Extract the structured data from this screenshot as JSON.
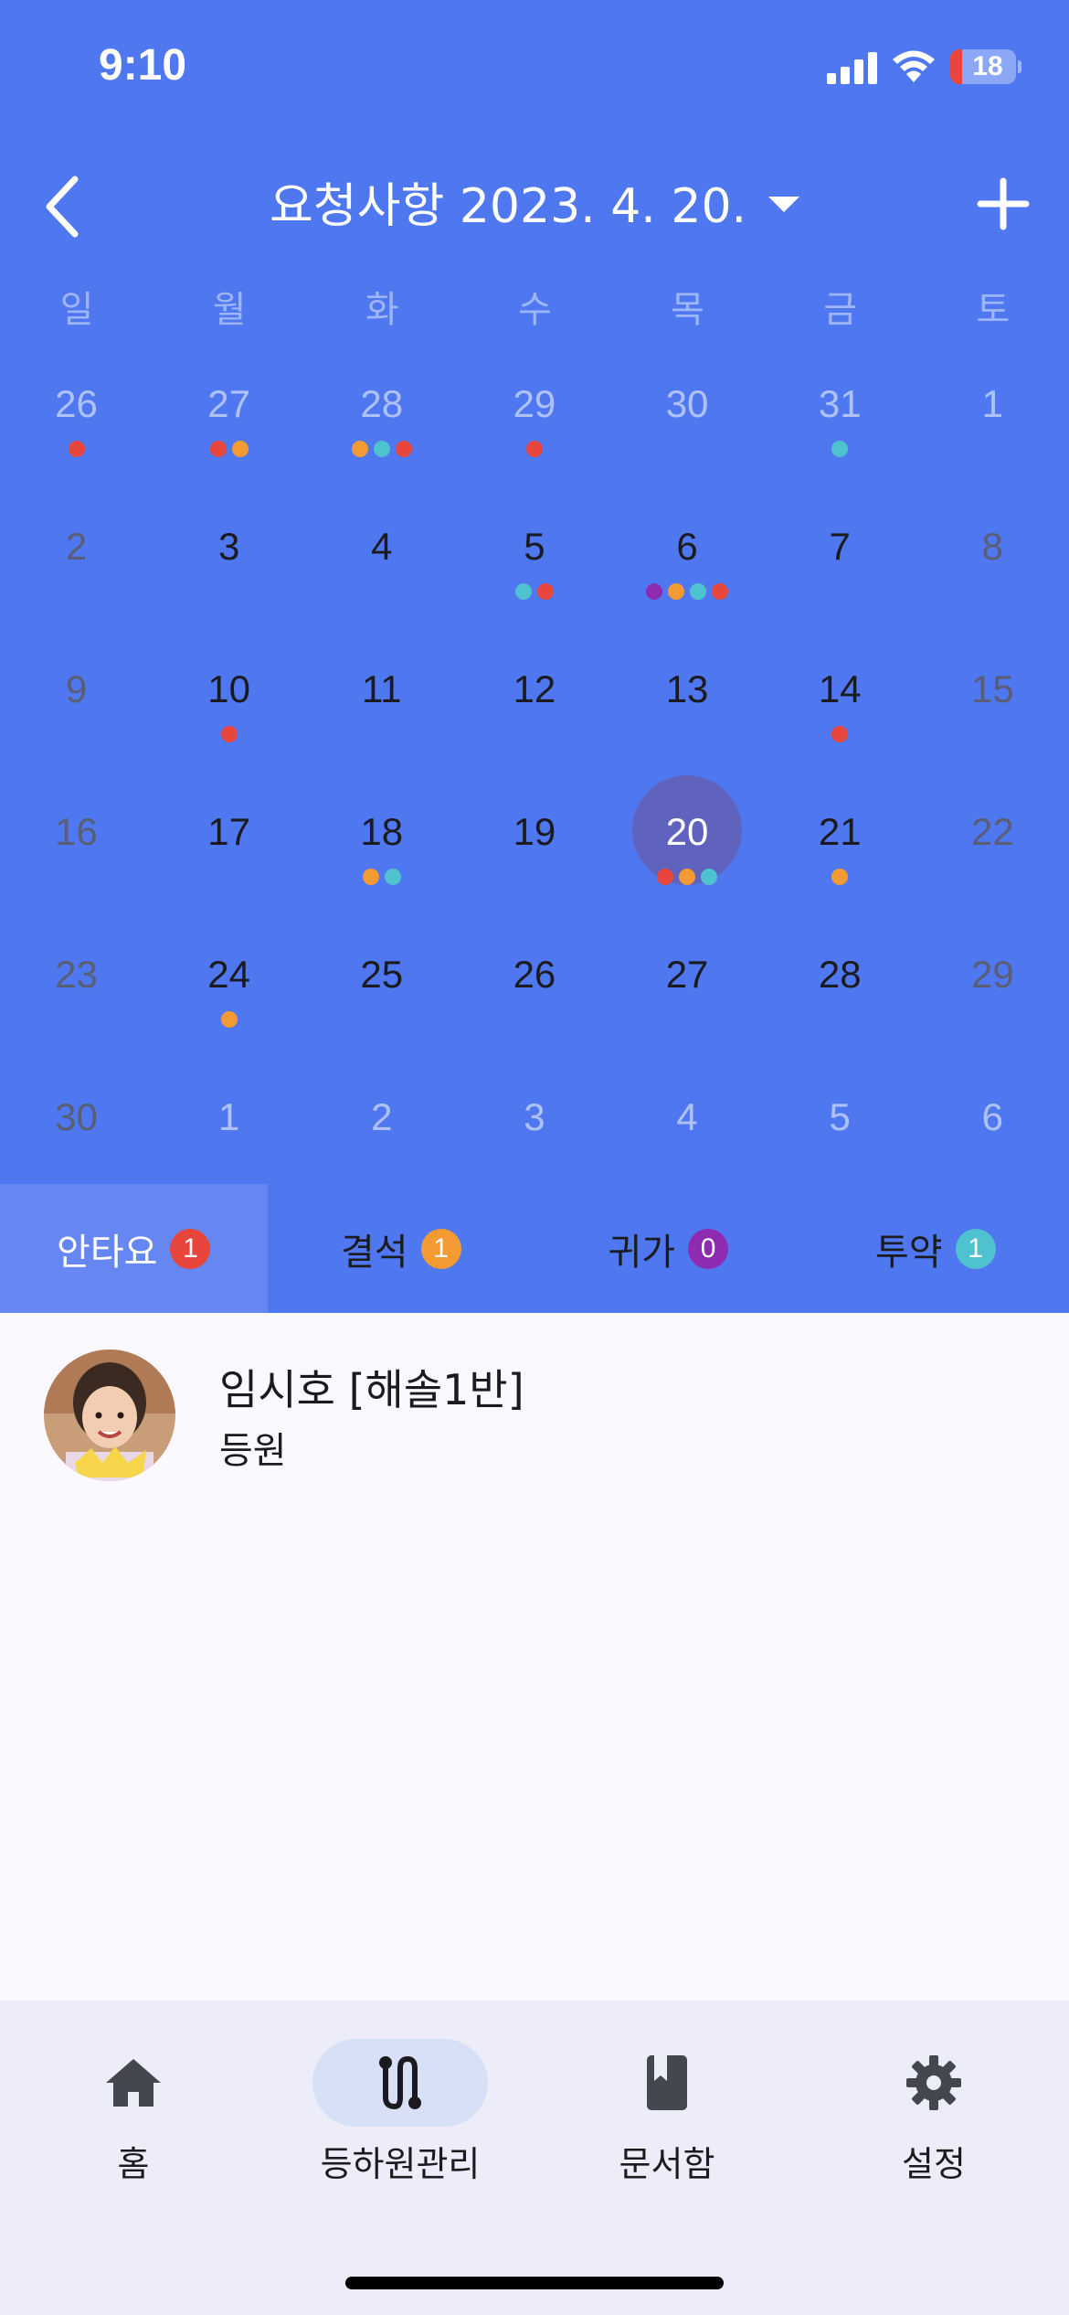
{
  "status_bar": {
    "time": "9:10",
    "battery": "18",
    "battery_level": 0.18
  },
  "header": {
    "title": "요청사항 2023. 4. 20."
  },
  "calendar": {
    "weekdays": [
      "일",
      "월",
      "화",
      "수",
      "목",
      "금",
      "토"
    ],
    "weeks": [
      [
        {
          "day": "26",
          "state": "out",
          "dots": [
            "#E8453C"
          ]
        },
        {
          "day": "27",
          "state": "out",
          "dots": [
            "#E8453C",
            "#F39A32"
          ]
        },
        {
          "day": "28",
          "state": "out",
          "dots": [
            "#F39A32",
            "#4FC2CF",
            "#E8453C"
          ]
        },
        {
          "day": "29",
          "state": "out",
          "dots": [
            "#E8453C"
          ]
        },
        {
          "day": "30",
          "state": "out",
          "dots": []
        },
        {
          "day": "31",
          "state": "out",
          "dots": [
            "#4FC2CF"
          ]
        },
        {
          "day": "1",
          "state": "out",
          "dots": []
        }
      ],
      [
        {
          "day": "2",
          "state": "wkend",
          "dots": []
        },
        {
          "day": "3",
          "state": "cur",
          "dots": []
        },
        {
          "day": "4",
          "state": "cur",
          "dots": []
        },
        {
          "day": "5",
          "state": "cur",
          "dots": [
            "#4FC2CF",
            "#E8453C"
          ]
        },
        {
          "day": "6",
          "state": "cur",
          "dots": [
            "#8E2BB0",
            "#F39A32",
            "#4FC2CF",
            "#E8453C"
          ]
        },
        {
          "day": "7",
          "state": "cur",
          "dots": []
        },
        {
          "day": "8",
          "state": "wkend",
          "dots": []
        }
      ],
      [
        {
          "day": "9",
          "state": "wkend",
          "dots": []
        },
        {
          "day": "10",
          "state": "cur",
          "dots": [
            "#E8453C"
          ]
        },
        {
          "day": "11",
          "state": "cur",
          "dots": []
        },
        {
          "day": "12",
          "state": "cur",
          "dots": []
        },
        {
          "day": "13",
          "state": "cur",
          "dots": []
        },
        {
          "day": "14",
          "state": "cur",
          "dots": [
            "#E8453C"
          ]
        },
        {
          "day": "15",
          "state": "wkend",
          "dots": []
        }
      ],
      [
        {
          "day": "16",
          "state": "wkend",
          "dots": []
        },
        {
          "day": "17",
          "state": "cur",
          "dots": []
        },
        {
          "day": "18",
          "state": "cur",
          "dots": [
            "#F39A32",
            "#4FC2CF"
          ]
        },
        {
          "day": "19",
          "state": "cur",
          "dots": []
        },
        {
          "day": "20",
          "state": "sel",
          "dots": [
            "#E8453C",
            "#F39A32",
            "#4FC2CF"
          ]
        },
        {
          "day": "21",
          "state": "cur",
          "dots": [
            "#F39A32"
          ]
        },
        {
          "day": "22",
          "state": "wkend",
          "dots": []
        }
      ],
      [
        {
          "day": "23",
          "state": "wkend",
          "dots": []
        },
        {
          "day": "24",
          "state": "cur",
          "dots": [
            "#F39A32"
          ]
        },
        {
          "day": "25",
          "state": "cur",
          "dots": []
        },
        {
          "day": "26",
          "state": "cur",
          "dots": []
        },
        {
          "day": "27",
          "state": "cur",
          "dots": []
        },
        {
          "day": "28",
          "state": "cur",
          "dots": []
        },
        {
          "day": "29",
          "state": "wkend",
          "dots": []
        }
      ],
      [
        {
          "day": "30",
          "state": "wkend",
          "dots": []
        },
        {
          "day": "1",
          "state": "out",
          "dots": []
        },
        {
          "day": "2",
          "state": "out",
          "dots": []
        },
        {
          "day": "3",
          "state": "out",
          "dots": []
        },
        {
          "day": "4",
          "state": "out",
          "dots": []
        },
        {
          "day": "5",
          "state": "out",
          "dots": []
        },
        {
          "day": "6",
          "state": "out",
          "dots": []
        }
      ]
    ]
  },
  "tabs": [
    {
      "label": "안타요",
      "count": "1",
      "color": "#E8453C",
      "active": true
    },
    {
      "label": "결석",
      "count": "1",
      "color": "#F39A32",
      "active": false
    },
    {
      "label": "귀가",
      "count": "0",
      "color": "#8E2BB0",
      "active": false
    },
    {
      "label": "투약",
      "count": "1",
      "color": "#4FC2CF",
      "active": false
    }
  ],
  "list": [
    {
      "name": "임시호 [해솔1반]",
      "sub": "등원",
      "avatar": "child-photo"
    }
  ],
  "bottom_nav": [
    {
      "label": "홈",
      "icon": "home-icon",
      "active": false
    },
    {
      "label": "등하원관리",
      "icon": "route-icon",
      "active": true
    },
    {
      "label": "문서함",
      "icon": "book-icon",
      "active": false
    },
    {
      "label": "설정",
      "icon": "gear-icon",
      "active": false
    }
  ],
  "colors": {
    "header_bg": "#4F78F0",
    "selected_day": "#5F63BE",
    "active_tab": "#6686F2",
    "nav_bg": "#ECEDF8",
    "nav_pill": "#D8E0F7"
  }
}
